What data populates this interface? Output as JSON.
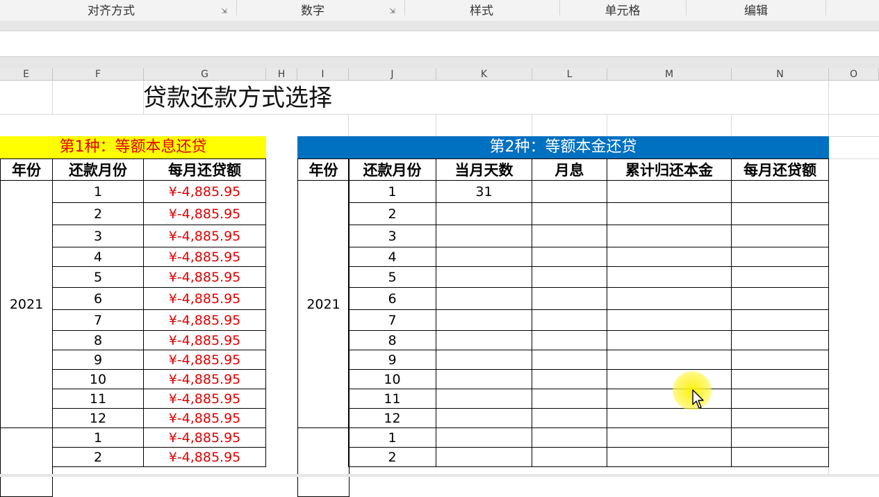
{
  "ribbon": {
    "groups": [
      "对齐方式",
      "数字",
      "样式",
      "单元格",
      "编辑"
    ]
  },
  "columns": [
    "E",
    "F",
    "G",
    "H",
    "I",
    "J",
    "K",
    "L",
    "M",
    "N",
    "O"
  ],
  "sheet": {
    "title": "贷款还款方式选择",
    "table1": {
      "banner": "第1种：等额本息还贷",
      "headers": [
        "年份",
        "还款月份",
        "每月还贷额"
      ],
      "year": "2021",
      "months": [
        "1",
        "2",
        "3",
        "4",
        "5",
        "6",
        "7",
        "8",
        "9",
        "10",
        "11",
        "12",
        "1",
        "2"
      ],
      "payment": "¥-4,885.95"
    },
    "table2": {
      "banner": "第2种：等额本金还贷",
      "headers": [
        "年份",
        "还款月份",
        "当月天数",
        "月息",
        "累计归还本金",
        "每月还贷额"
      ],
      "year": "2021",
      "months": [
        "1",
        "2",
        "3",
        "4",
        "5",
        "6",
        "7",
        "8",
        "9",
        "10",
        "11",
        "12",
        "1",
        "2"
      ],
      "days_first_row": "31"
    }
  },
  "colors": {
    "banner1_bg": "#ffff00",
    "banner1_text": "#e00000",
    "banner2_bg": "#0070c0",
    "banner2_text": "#ffffff",
    "payment_text": "#e00000"
  }
}
